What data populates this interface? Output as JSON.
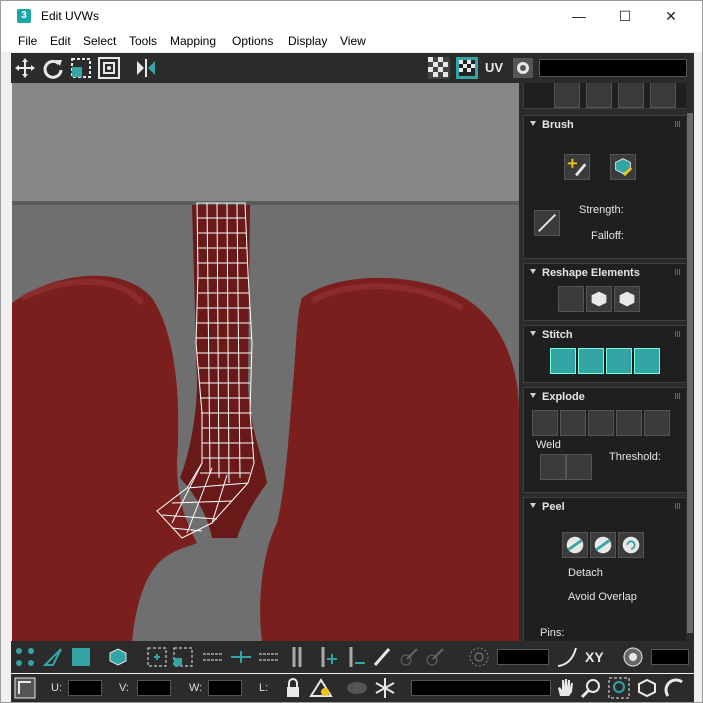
{
  "window": {
    "title": "Edit UVWs",
    "app_icon_glyph": "3",
    "controls": {
      "minimize": "—",
      "maximize": "☐",
      "close": "✕"
    }
  },
  "menu": [
    "File",
    "Edit",
    "Select",
    "Tools",
    "Mapping",
    "Options",
    "Display",
    "View"
  ],
  "top_toolbar": {
    "uv_label": "UV",
    "icons": [
      "move-icon",
      "rotate-icon",
      "scale-icon",
      "freeform-icon",
      "mirror-icon",
      "checker-pattern-icon",
      "checker-map-icon",
      "uv-channel-icon",
      "settings-map-icon"
    ]
  },
  "panel": {
    "brush": {
      "title": "Brush",
      "strength_label": "Strength:",
      "falloff_label": "Falloff:"
    },
    "reshape": {
      "title": "Reshape Elements"
    },
    "stitch": {
      "title": "Stitch"
    },
    "explode": {
      "title": "Explode",
      "weld_label": "Weld",
      "threshold_label": "Threshold:"
    },
    "peel": {
      "title": "Peel",
      "detach_label": "Detach",
      "avoid_overlap_label": "Avoid Overlap",
      "pins_label": "Pins:"
    }
  },
  "bottom_toolbar": {
    "xy_label": "XY",
    "u_label": "U:",
    "v_label": "V:",
    "w_label": "W:",
    "l_label": "L:"
  },
  "colors": {
    "accent_teal": "#34a5a5",
    "panel_bg": "#2b2b2b",
    "lung_red": "#7a1e1e",
    "uv_wire": "#ffffff"
  }
}
